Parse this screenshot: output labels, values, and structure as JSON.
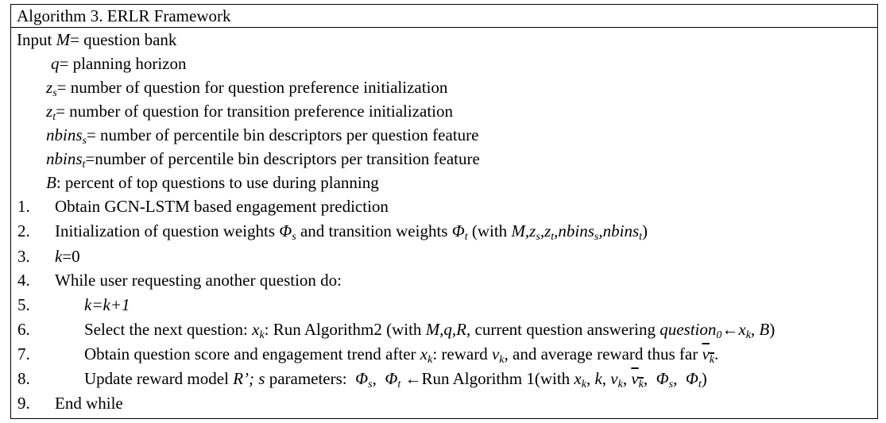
{
  "title": "Algorithm 3. ERLR Framework",
  "inputs": {
    "label": "Input",
    "M": "M= question bank",
    "q": "q= planning horizon",
    "zs": "= number of question for question preference initialization",
    "zt": "= number of question for transition preference initialization",
    "nbins_s": "= number of percentile bin descriptors per question feature",
    "nbins_t": "=number of percentile bin descriptors per transition feature",
    "B": ": percent of top questions to use during planning"
  },
  "steps": [
    {
      "num": "1.",
      "text": "Obtain GCN-LSTM based engagement prediction"
    },
    {
      "num": "2.",
      "text": "Initialization of question weights Φs and transition weights Φt (with M,zs,zt,nbinss,nbinst)"
    },
    {
      "num": "3.",
      "text": "k=0"
    },
    {
      "num": "4.",
      "text": "While user requesting another question do:"
    },
    {
      "num": "5.",
      "text": "k=k+1"
    },
    {
      "num": "6.",
      "text": "Select the next question: xk: Run Algorithm2 (with M,q,R, current question answering question0←xk, B)"
    },
    {
      "num": "7.",
      "text": "Obtain question score and engagement trend after xk: reward vk, and average reward thus far vk."
    },
    {
      "num": "8.",
      "text": "Update reward model R’; s parameters: Φs, Φt ←Run Algorithm 1(with xk, k, vk, vk, Φs, Φt)"
    },
    {
      "num": "9.",
      "text": "End while"
    }
  ]
}
